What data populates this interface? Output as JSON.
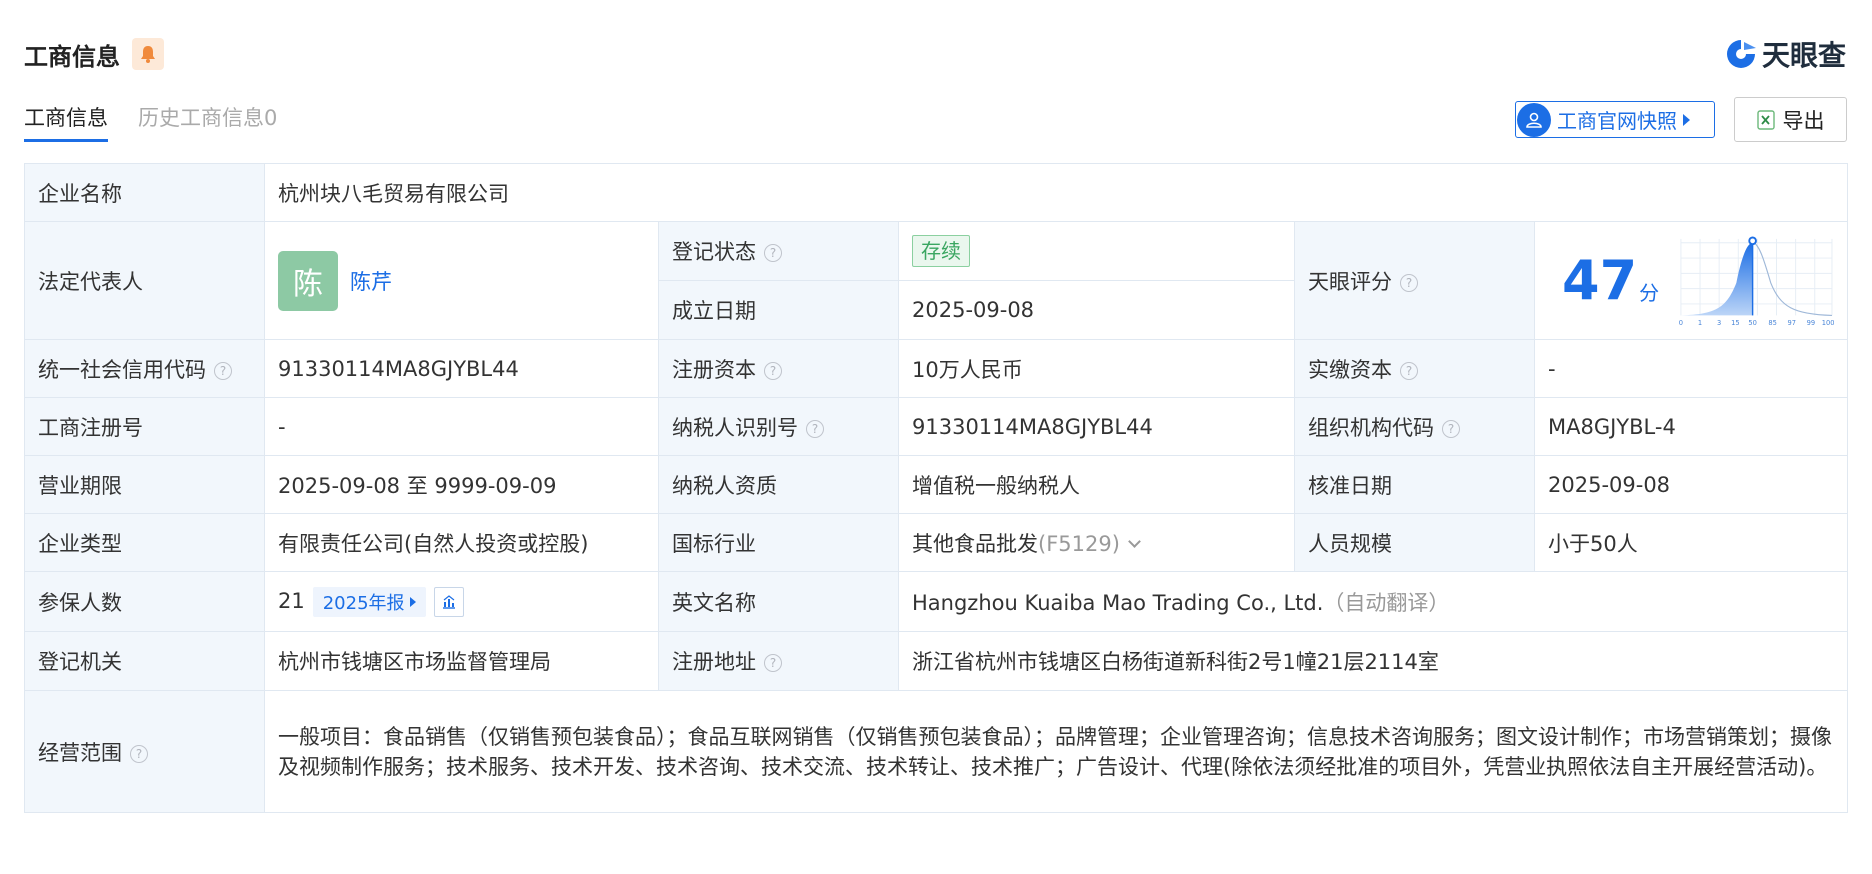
{
  "header": {
    "title": "工商信息"
  },
  "logo": {
    "text": "天眼查"
  },
  "tabs": [
    {
      "label": "工商信息",
      "active": true
    },
    {
      "label": "历史工商信息0",
      "active": false
    }
  ],
  "actions": {
    "snapshot": "工商官网快照",
    "export": "导出"
  },
  "colors": {
    "accent": "#1c6ee5",
    "label_bg": "#f2f7fc",
    "status_green": "#3aa661",
    "avatar_bg": "#8dc9a4"
  },
  "icons": {
    "bell": "bell-icon",
    "snapshot": "person-icon",
    "export": "excel-icon",
    "help": "question-icon",
    "chart": "bar-chart-icon"
  },
  "company": {
    "name_label": "企业名称",
    "name": "杭州块八毛贸易有限公司",
    "legal_label": "法定代表人",
    "legal_avatar": "陈",
    "legal_name": "陈芹",
    "status_label": "登记状态",
    "status": "存续",
    "founded_label": "成立日期",
    "founded": "2025-09-08",
    "score_label": "天眼评分",
    "score": "47",
    "score_unit": "分",
    "score_ticks": [
      "0",
      "1",
      "3",
      "15",
      "50",
      "85",
      "97",
      "99",
      "100"
    ],
    "credit_label": "统一社会信用代码",
    "credit_code": "91330114MA8GJYBL44",
    "capital_label": "注册资本",
    "capital": "10万人民币",
    "paid_label": "实缴资本",
    "paid": "-",
    "regno_label": "工商注册号",
    "regno": "-",
    "taxid_label": "纳税人识别号",
    "taxid": "91330114MA8GJYBL44",
    "orgcode_label": "组织机构代码",
    "orgcode": "MA8GJYBL-4",
    "term_label": "营业期限",
    "term": "2025-09-08 至 9999-09-09",
    "taxqual_label": "纳税人资质",
    "taxqual": "增值税一般纳税人",
    "approve_label": "核准日期",
    "approve": "2025-09-08",
    "type_label": "企业类型",
    "type": "有限责任公司(自然人投资或控股)",
    "industry_label": "国标行业",
    "industry": "其他食品批发",
    "industry_code": "(F5129)",
    "staff_label": "人员规模",
    "staff": "小于50人",
    "insured_label": "参保人数",
    "insured": "21",
    "insured_report": "2025年报",
    "en_label": "英文名称",
    "en_name": "Hangzhou Kuaiba Mao Trading Co., Ltd.",
    "en_note": "（自动翻译）",
    "authority_label": "登记机关",
    "authority": "杭州市钱塘区市场监督管理局",
    "address_label": "注册地址",
    "address": "浙江省杭州市钱塘区白杨街道新科街2号1幢21层2114室",
    "scope_label": "经营范围",
    "scope": "一般项目：食品销售（仅销售预包装食品）；食品互联网销售（仅销售预包装食品）；品牌管理；企业管理咨询；信息技术咨询服务；图文设计制作；市场营销策划；摄像及视频制作服务；技术服务、技术开发、技术咨询、技术交流、技术转让、技术推广；广告设计、代理(除依法须经批准的项目外，凭营业执照依法自主开展经营活动)。"
  }
}
